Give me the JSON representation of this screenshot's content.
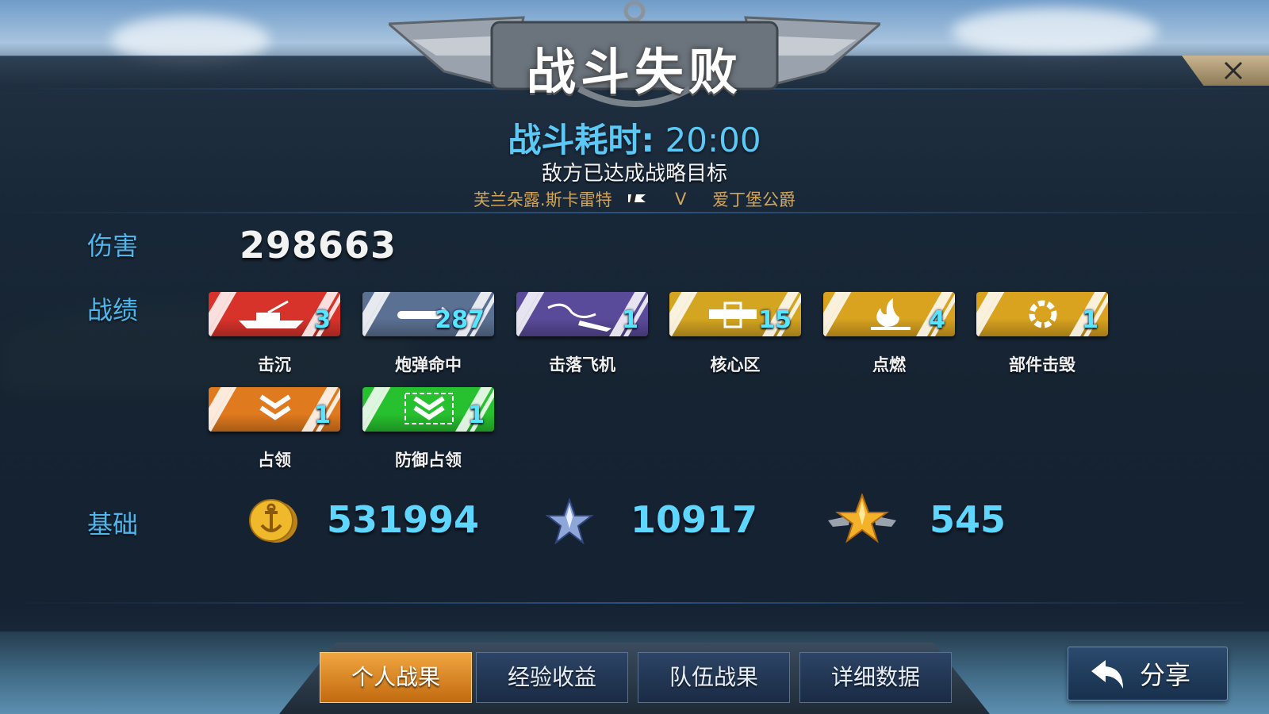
{
  "header": {
    "title": "战斗失败",
    "duration_label": "战斗耗时:",
    "duration_value": "20:00",
    "result_message": "敌方已达成战略目标",
    "player_ship": "芙兰朵露.斯卡雷特",
    "vs_text": "V",
    "enemy_ship": "爱丁堡公爵"
  },
  "damage": {
    "label": "伤害",
    "value": "298663"
  },
  "achievements": {
    "label": "战绩",
    "items": [
      {
        "name": "击沉",
        "count": "3",
        "color": "#d8332b",
        "icon": "warship-sinking-icon"
      },
      {
        "name": "炮弹命中",
        "count": "287",
        "color": "#5b7193",
        "icon": "shell-hit-icon"
      },
      {
        "name": "击落飞机",
        "count": "1",
        "color": "#5a4a9a",
        "icon": "plane-down-icon"
      },
      {
        "name": "核心区",
        "count": "15",
        "color": "#d4a521",
        "icon": "core-zone-icon"
      },
      {
        "name": "点燃",
        "count": "4",
        "color": "#d9a320",
        "icon": "fire-icon"
      },
      {
        "name": "部件击毁",
        "count": "1",
        "color": "#d9a320",
        "icon": "gear-broken-icon"
      },
      {
        "name": "占领",
        "count": "1",
        "color": "#e07a1e",
        "icon": "chevron-down-icon"
      },
      {
        "name": "防御占领",
        "count": "1",
        "color": "#27c12f",
        "icon": "chevron-defend-icon"
      }
    ]
  },
  "base": {
    "label": "基础",
    "gold": "531994",
    "exp": "10917",
    "rank": "545"
  },
  "tabs": [
    {
      "label": "个人战果",
      "active": true
    },
    {
      "label": "经验收益",
      "active": false
    },
    {
      "label": "队伍战果",
      "active": false
    },
    {
      "label": "详细数据",
      "active": false
    }
  ],
  "share": {
    "label": "分享"
  }
}
